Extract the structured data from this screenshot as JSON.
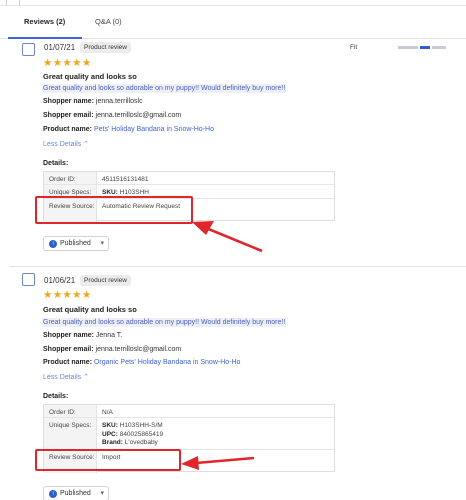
{
  "tabs": [
    {
      "label": "Reviews (2)",
      "active": true
    },
    {
      "label": "Q&A (0)",
      "active": false
    }
  ],
  "reviews": [
    {
      "date": "01/07/21",
      "badge": "Product review",
      "stars": "★★★★★",
      "rating": 5,
      "title": "Great quality and looks so",
      "body": "Great quality and looks so adorable on my puppy!! Would definitely buy more!!",
      "fit_label": "Fit",
      "shopper_name_label": "Shopper name:",
      "shopper_name": "jenna.terrilloslc",
      "shopper_email_label": "Shopper email:",
      "shopper_email": "jenna.terrilloslc@gmail.com",
      "product_name_label": "Product name:",
      "product_name": "Pets' Holiday Bandana in Snow-Ho-Ho",
      "less_details": "Less Details",
      "details_heading": "Details:",
      "order_id_label": "Order ID:",
      "order_id": "4511516131481",
      "unique_specs_label": "Unique Specs:",
      "sku_label": "SKU:",
      "sku": "H103SHH",
      "review_source_label": "Review Source:",
      "review_source": "Automatic Review Request",
      "status": "Published"
    },
    {
      "date": "01/06/21",
      "badge": "Product review",
      "stars": "★★★★★",
      "rating": 5,
      "title": "Great quality and looks so",
      "body": "Great quality and looks so adorable on my puppy!! Would definitely buy more!!",
      "shopper_name_label": "Shopper name:",
      "shopper_name": "Jenna T.",
      "shopper_email_label": "Shopper email:",
      "shopper_email": "jenna.terrilloslc@gmail.com",
      "product_name_label": "Product name:",
      "product_name": "Organic Pets' Holiday Bandana in Snow-Ho-Ho",
      "less_details": "Less Details",
      "details_heading": "Details:",
      "order_id_label": "Order ID:",
      "order_id": "N/A",
      "unique_specs_label": "Unique Specs:",
      "sku_label": "SKU:",
      "sku": "H103SHH-S/M",
      "upc_label": "UPC:",
      "upc": "840025865419",
      "brand_label": "Brand:",
      "brand": "L'ovedbaby",
      "review_source_label": "Review Source:",
      "review_source": "Import",
      "status": "Published"
    }
  ],
  "colors": {
    "accent": "#3f63d8",
    "star": "#f2a413",
    "annotation": "#e0262b"
  }
}
